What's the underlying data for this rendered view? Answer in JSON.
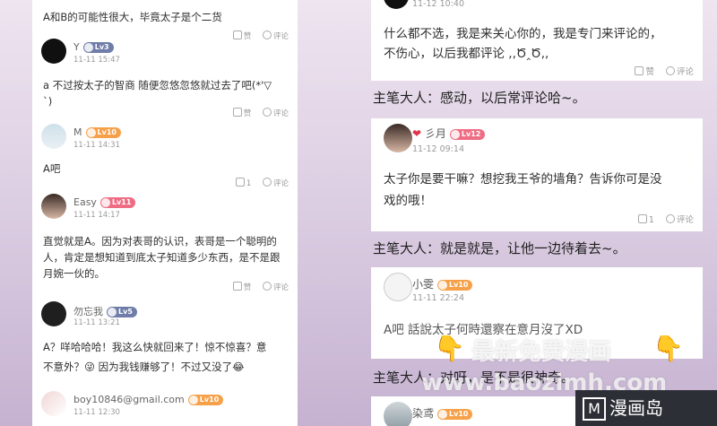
{
  "left": {
    "comments": [
      {
        "text": "A和B的可能性很大，毕竟太子是个二货",
        "like": "赞",
        "comment": "评论"
      },
      {
        "user": "Y",
        "level": "Lv3",
        "time": "11-11 15:47",
        "text1": "a  不过按太子的智商 随便忽悠忽悠就过去了吧(*'▽",
        "text2": "`)",
        "like": "赞",
        "comment": "评论"
      },
      {
        "user": "M",
        "level": "Lv10",
        "time": "11-11 14:31",
        "text": "A吧",
        "like_count": "1",
        "comment": "评论"
      },
      {
        "user": "Easy",
        "level": "Lv11",
        "time": "11-11 14:17",
        "text1": "直觉就是A。因为对表哥的认识，表哥是一个聪明的",
        "text2": "人，肯定是想知道到底太子知道多少东西，是不是跟",
        "text3": "月婉一伙的。",
        "like": "赞",
        "comment": "评论"
      },
      {
        "user": "勿忘我",
        "level": "Lv5",
        "time": "11-11 13:21",
        "text1": "A？咩哈哈哈！我这么快就回来了！惊不惊喜？意",
        "text2": "不意外？😜 因为我钱赚够了！不过又没了😂"
      },
      {
        "user": "boy10846@gmail.com",
        "level": "Lv10",
        "time": "11-11 12:30"
      }
    ]
  },
  "right": {
    "top_time": "11-12 10:40",
    "first_text1": "什么都不选，我是来关心你的，我是专门来评论的，",
    "first_text2": "不伤心，以后我都评论 ,,Ծ‸Ծ,,",
    "like": "赞",
    "comment": "评论",
    "narr1": "主笔大人：感动，以后常评论哈~。",
    "second": {
      "heart": "❤",
      "user": "彡月",
      "level": "Lv12",
      "time": "11-12 09:14",
      "text1": "太子你是要干嘛？想挖我王爷的墙角？告诉你可是没",
      "text2": "戏的哦！",
      "like_count": "1",
      "comment": "评论"
    },
    "narr2": "主笔大人：就是就是，让他一边待着去~。",
    "third": {
      "user": "小雯",
      "level": "Lv10",
      "time": "11-11 22:24",
      "text": "A吧  話說太子何時還察在意月沒了XD"
    },
    "narr3": "主笔大人：对呀，是不是很神奇。",
    "fourth": {
      "user": "染鸢",
      "level": "Lv10"
    }
  },
  "watermark": {
    "line1": "最新免费漫画",
    "line2": "www.baozimh.com",
    "logo": "漫画岛",
    "logo_letter": "M"
  }
}
